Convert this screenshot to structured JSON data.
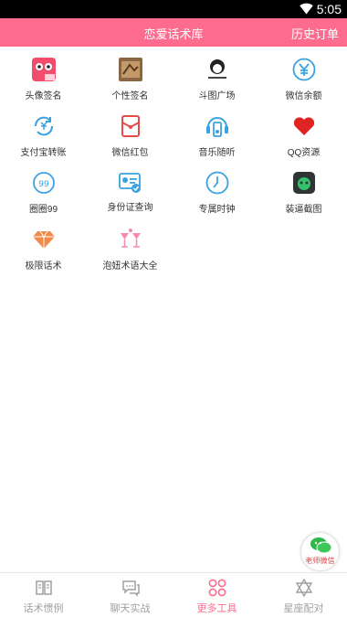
{
  "status_bar": {
    "time": "5:05",
    "icons": [
      "wifi-icon"
    ]
  },
  "header": {
    "title": "恋爱话术库",
    "right_action": "历史订单"
  },
  "colors": {
    "accent": "#fd6c8f",
    "inactive": "#a0a0a0",
    "text": "#333333"
  },
  "tools": [
    {
      "label": "头像签名",
      "icon": "avatar-sticker-icon"
    },
    {
      "label": "个性签名",
      "icon": "signature-photo-icon"
    },
    {
      "label": "斗图广场",
      "icon": "meme-icon"
    },
    {
      "label": "微信余额",
      "icon": "yen-icon"
    },
    {
      "label": "支付宝转账",
      "icon": "alipay-transfer-icon"
    },
    {
      "label": "微信红包",
      "icon": "red-envelope-icon"
    },
    {
      "label": "音乐随听",
      "icon": "music-player-icon"
    },
    {
      "label": "QQ资源",
      "icon": "heart-icon"
    },
    {
      "label": "圈圈99",
      "icon": "circle-99-icon"
    },
    {
      "label": "身份证查询",
      "icon": "id-card-icon"
    },
    {
      "label": "专属时钟",
      "icon": "clock-icon"
    },
    {
      "label": "装逼截图",
      "icon": "screenshot-app-icon"
    },
    {
      "label": "极限话术",
      "icon": "diamond-icon"
    },
    {
      "label": "泡妞术语大全",
      "icon": "cocktail-icon"
    }
  ],
  "floating_button": {
    "label": "老师微信",
    "icon": "wechat-icon"
  },
  "bottom_nav": [
    {
      "label": "话术惯例",
      "icon": "book-icon",
      "active": false
    },
    {
      "label": "聊天实战",
      "icon": "chat-icon",
      "active": false
    },
    {
      "label": "更多工具",
      "icon": "grid-circles-icon",
      "active": true
    },
    {
      "label": "星座配对",
      "icon": "star-of-david-icon",
      "active": false
    }
  ]
}
